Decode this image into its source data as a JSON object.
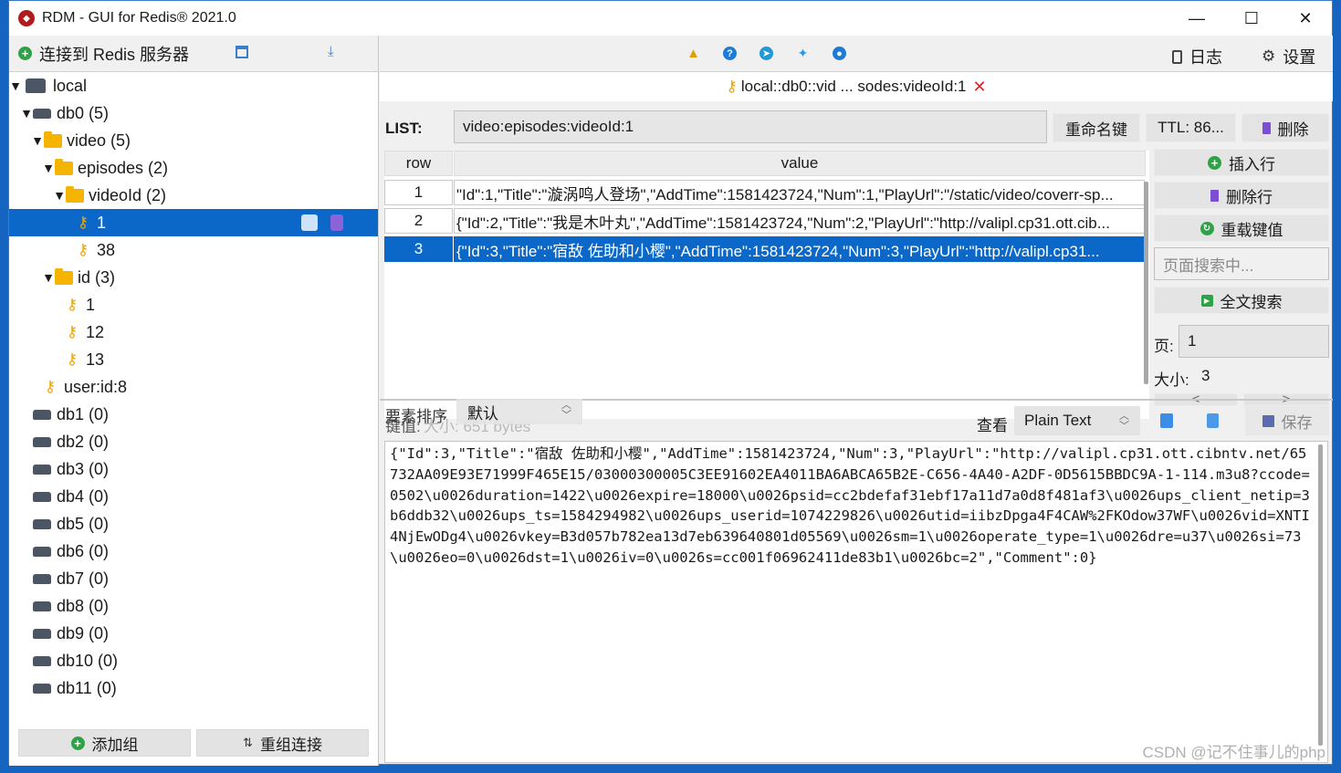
{
  "titlebar": {
    "title": "RDM - GUI for Redis® 2021.0",
    "minimize": "—",
    "maximize": "☐",
    "close": "✕"
  },
  "left": {
    "connect_label": "连接到 Redis 服务器",
    "tree": [
      {
        "label": "local",
        "type": "server",
        "arrow": "▼"
      },
      {
        "label": "db0  (5)",
        "type": "db",
        "arrow": "▼"
      },
      {
        "label": "video (5)",
        "type": "folder",
        "arrow": "▼"
      },
      {
        "label": "episodes (2)",
        "type": "folder",
        "arrow": "▼"
      },
      {
        "label": "videoId (2)",
        "type": "folder",
        "arrow": "▼"
      },
      {
        "label": "1",
        "type": "key",
        "selected": true
      },
      {
        "label": "38",
        "type": "key"
      },
      {
        "label": "id (3)",
        "type": "folder",
        "arrow": "▼"
      },
      {
        "label": "1",
        "type": "key"
      },
      {
        "label": "12",
        "type": "key"
      },
      {
        "label": "13",
        "type": "key"
      },
      {
        "label": "user:id:8",
        "type": "key"
      },
      {
        "label": "db1  (0)",
        "type": "db"
      },
      {
        "label": "db2  (0)",
        "type": "db"
      },
      {
        "label": "db3  (0)",
        "type": "db"
      },
      {
        "label": "db4  (0)",
        "type": "db"
      },
      {
        "label": "db5  (0)",
        "type": "db"
      },
      {
        "label": "db6  (0)",
        "type": "db"
      },
      {
        "label": "db7  (0)",
        "type": "db"
      },
      {
        "label": "db8  (0)",
        "type": "db"
      },
      {
        "label": "db9  (0)",
        "type": "db"
      },
      {
        "label": "db10  (0)",
        "type": "db"
      },
      {
        "label": "db11  (0)",
        "type": "db"
      }
    ],
    "add_group": "添加组",
    "reorder": "重组连接"
  },
  "toolbar": {
    "log": "日志",
    "settings": "设置"
  },
  "tab": {
    "label": "local::db0::vid ... sodes:videoId:1",
    "close": "✕"
  },
  "key": {
    "type_label": "LIST:",
    "name": "video:episodes:videoId:1",
    "rename": "重命名键",
    "ttl": "TTL:  86...",
    "delete": "删除"
  },
  "table": {
    "headers": {
      "row": "row",
      "value": "value"
    },
    "rows": [
      {
        "row": "1",
        "value": "\"Id\":1,\"Title\":\"漩涡鸣人登场\",\"AddTime\":1581423724,\"Num\":1,\"PlayUrl\":\"/static/video/coverr-sp..."
      },
      {
        "row": "2",
        "value": "{\"Id\":2,\"Title\":\"我是木叶丸\",\"AddTime\":1581423724,\"Num\":2,\"PlayUrl\":\"http://valipl.cp31.ott.cib..."
      },
      {
        "row": "3",
        "value": "{\"Id\":3,\"Title\":\"宿敌 佐助和小樱\",\"AddTime\":1581423724,\"Num\":3,\"PlayUrl\":\"http://valipl.cp31...",
        "selected": true
      }
    ]
  },
  "side": {
    "insert_row": "插入行",
    "delete_row": "删除行",
    "reload": "重载键值",
    "search_placeholder": "页面搜索中...",
    "fulltext": "全文搜索",
    "page_label": "页:",
    "page_value": "1",
    "size_label": "大小:",
    "size_value": "3",
    "prev": "<",
    "next": ">"
  },
  "value_bar": {
    "sort_label": "要素排序",
    "sort_value": "默认",
    "key_value_label": "键值:",
    "size_hint": "大小: 651 bytes",
    "view_label": "查看",
    "view_format": "Plain Text",
    "save": "保存"
  },
  "editor_text": "{\"Id\":3,\"Title\":\"宿敌 佐助和小樱\",\"AddTime\":1581423724,\"Num\":3,\"PlayUrl\":\"http://valipl.cp31.ott.cibntv.net/65732AA09E93E71999F465E15/03000300005C3EE91602EA4011BA6ABCA65B2E-C656-4A40-A2DF-0D5615BBDC9A-1-114.m3u8?ccode=0502\\u0026duration=1422\\u0026expire=18000\\u0026psid=cc2bdefaf31ebf17a11d7a0d8f481af3\\u0026ups_client_netip=3b6ddb32\\u0026ups_ts=1584294982\\u0026ups_userid=1074229826\\u0026utid=iibzDpga4F4CAW%2FKOdow37WF\\u0026vid=XNTI4NjEwODg4\\u0026vkey=B3d057b782ea13d7eb639640801d05569\\u0026sm=1\\u0026operate_type=1\\u0026dre=u37\\u0026si=73\\u0026eo=0\\u0026dst=1\\u0026iv=0\\u0026s=cc001f06962411de83b1\\u0026bc=2\",\"Comment\":0}",
  "watermark": "CSDN @记不住事儿的php",
  "colors": {
    "accent": "#0b68c8",
    "key": "#f0a500",
    "folder": "#f4b400"
  }
}
